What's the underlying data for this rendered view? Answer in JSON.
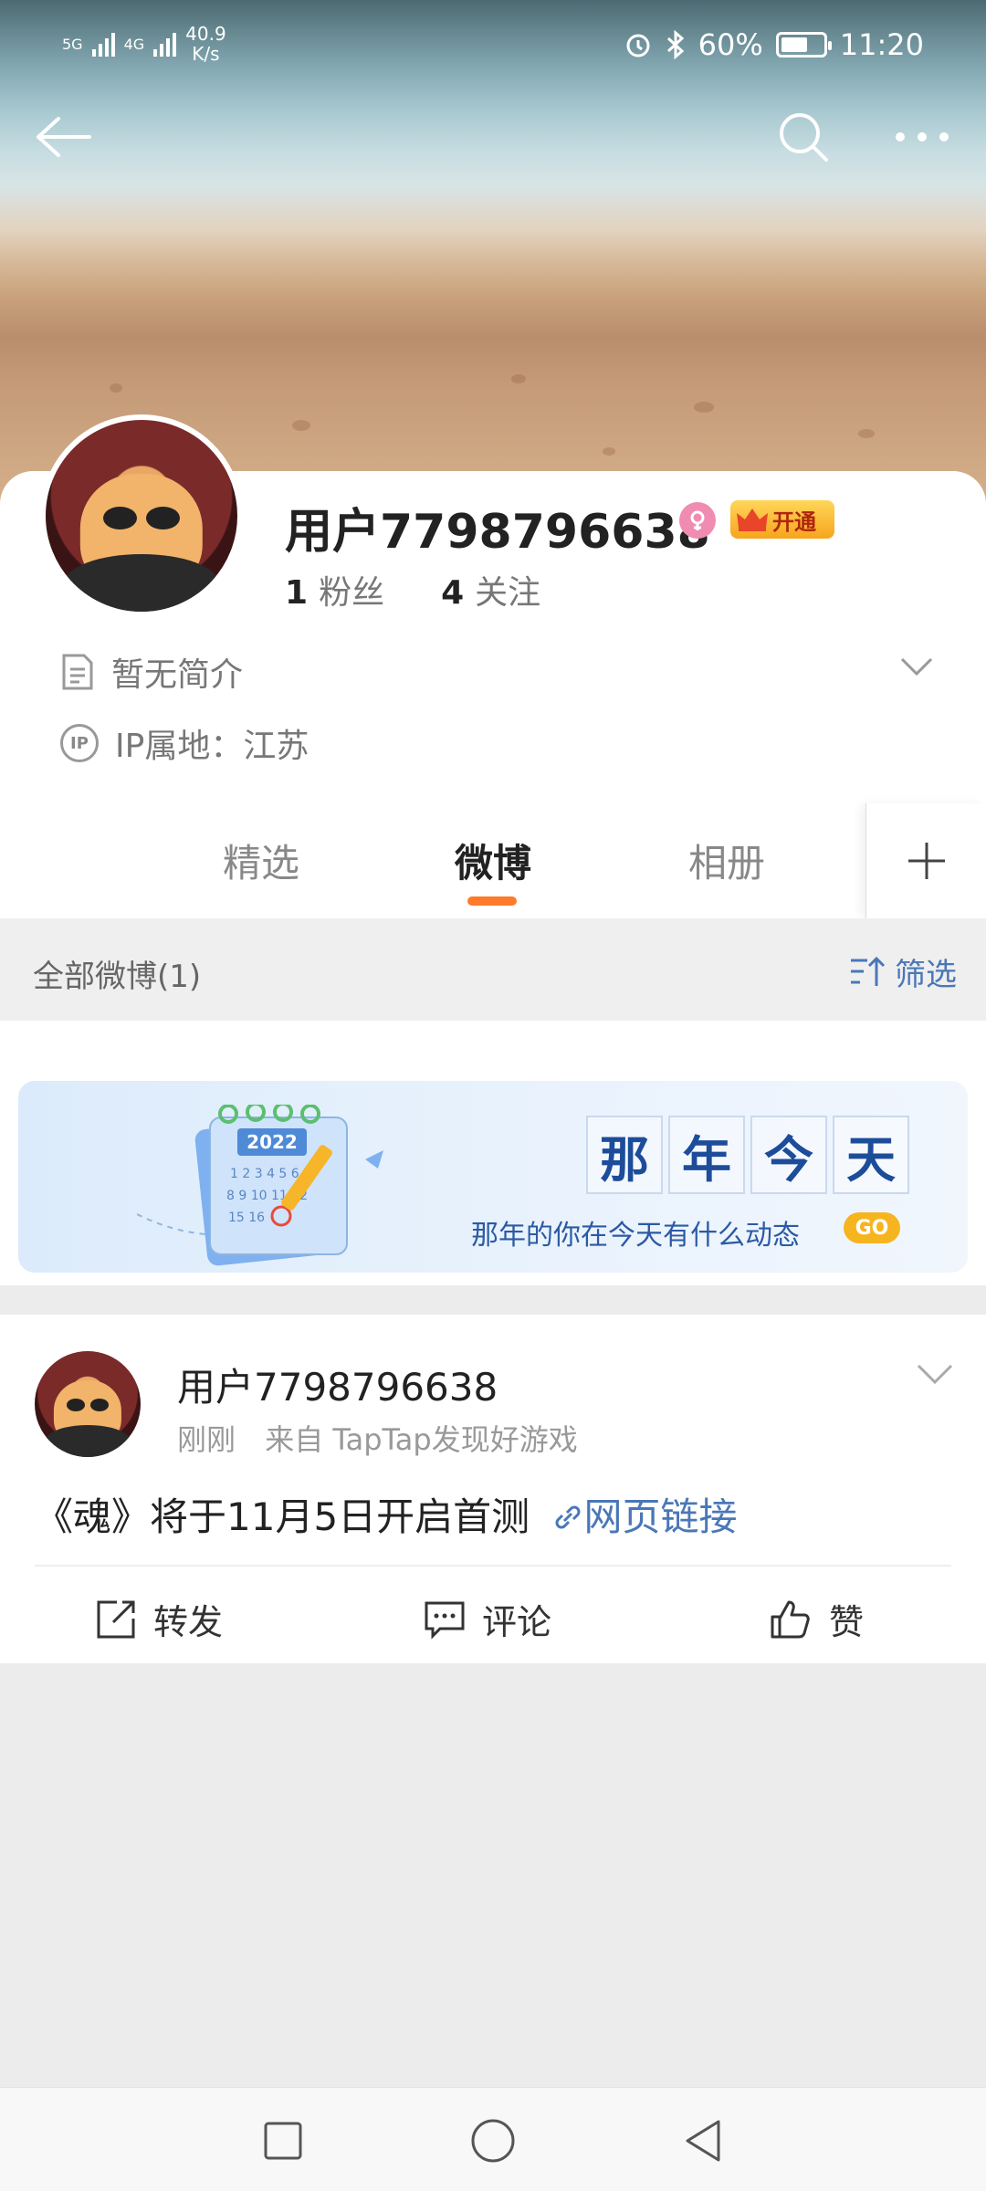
{
  "status_bar": {
    "net_speed_value": "40.9",
    "net_speed_unit": "K/s",
    "sim1": "5G",
    "sim2": "4G",
    "battery": "60%",
    "time": "11:20"
  },
  "profile": {
    "username": "用户7798796638",
    "vip_label": "开通",
    "fans_count": "1",
    "fans_label": "粉丝",
    "follow_count": "4",
    "follow_label": "关注",
    "bio": "暂无简介",
    "ip_badge": "IP",
    "ip_location": "IP属地：江苏"
  },
  "tabs": [
    {
      "label": "精选",
      "active": false
    },
    {
      "label": "微博",
      "active": true
    },
    {
      "label": "相册",
      "active": false
    }
  ],
  "filter": {
    "title": "全部微博(1)",
    "button": "筛选"
  },
  "banner": {
    "year": "2022",
    "title_chars": [
      "那",
      "年",
      "今",
      "天"
    ],
    "subtitle": "那年的你在今天有什么动态",
    "go": "GO"
  },
  "post": {
    "username": "用户7798796638",
    "time": "刚刚",
    "source": "来自 TapTap发现好游戏",
    "text": "《魂》将于11月5日开启首测",
    "link": "网页链接",
    "actions": {
      "repost": "转发",
      "comment": "评论",
      "like": "赞"
    }
  },
  "colors": {
    "accent_orange": "#ff7a2a",
    "link_blue": "#4a77b6"
  }
}
